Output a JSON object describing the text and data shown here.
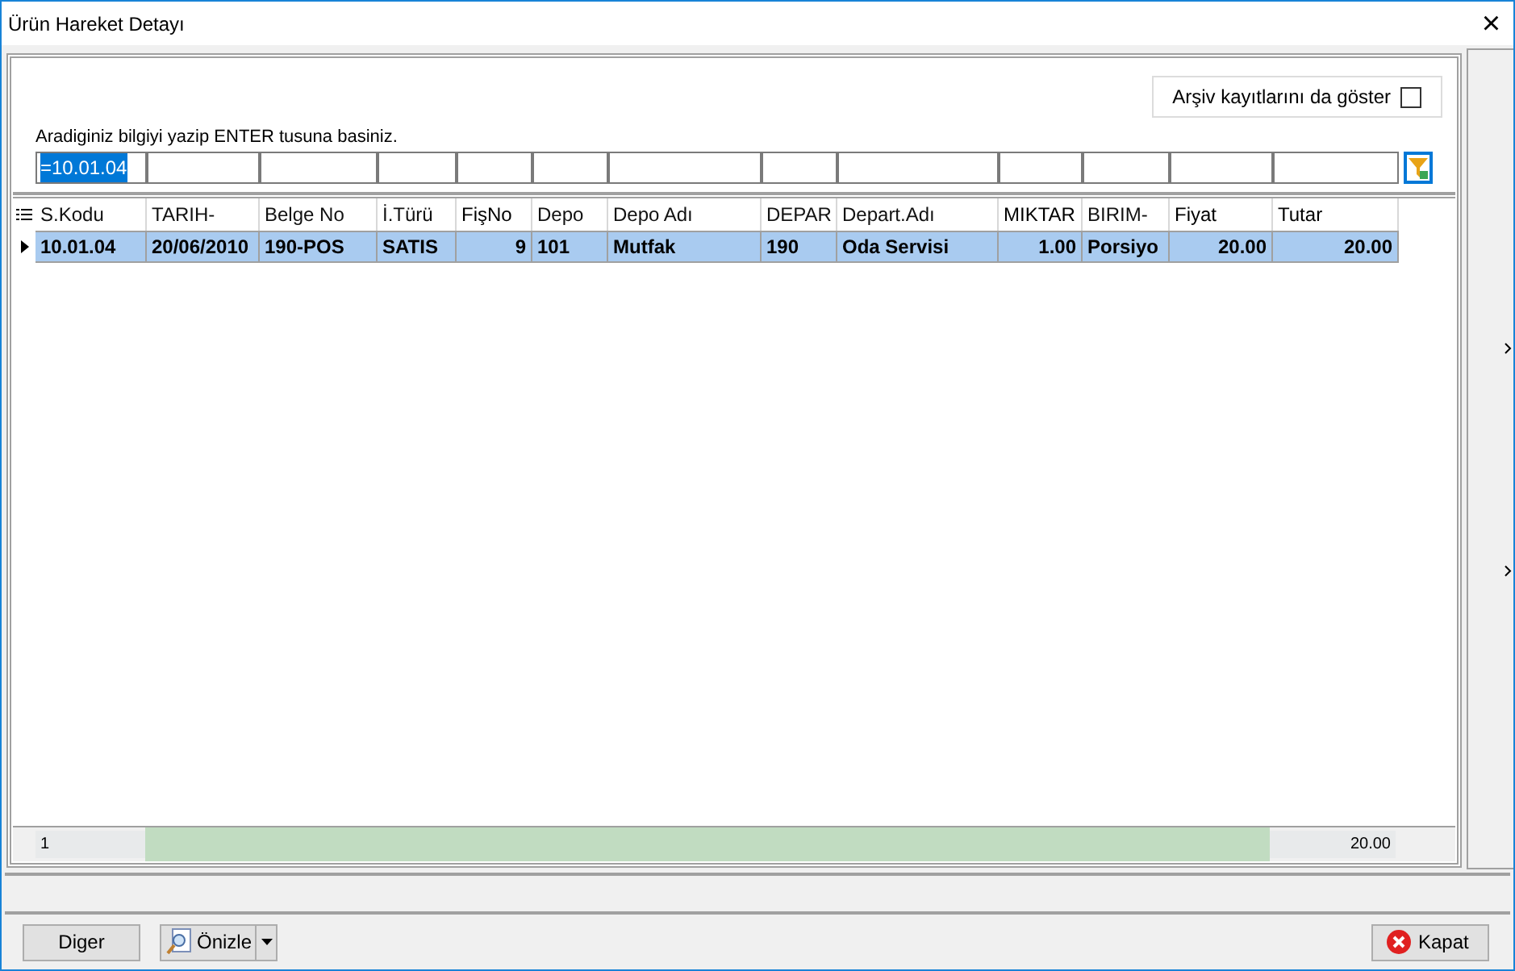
{
  "window": {
    "title": "Ürün Hareket Detayı",
    "close": "×"
  },
  "archive_checkbox": {
    "label": "Arşiv kayıtlarını da göster",
    "checked": false
  },
  "search_hint": "Aradiginiz bilgiyi yazip ENTER tusuna basiniz.",
  "search_field": {
    "value": "=10.01.04",
    "selected": true
  },
  "table": {
    "columns": [
      {
        "label": "S.Kodu",
        "kind": "text"
      },
      {
        "label": "TARIH-",
        "kind": "text"
      },
      {
        "label": "Belge No",
        "kind": "text"
      },
      {
        "label": "İ.Türü",
        "kind": "text"
      },
      {
        "label": "FişNo",
        "kind": "number"
      },
      {
        "label": "Depo",
        "kind": "text"
      },
      {
        "label": "Depo Adı",
        "kind": "text"
      },
      {
        "label": "DEPAR",
        "kind": "text"
      },
      {
        "label": "Depart.Adı",
        "kind": "text"
      },
      {
        "label": "MIKTAR",
        "kind": "number"
      },
      {
        "label": "BIRIM-",
        "kind": "text"
      },
      {
        "label": "Fiyat",
        "kind": "number"
      },
      {
        "label": "Tutar",
        "kind": "number"
      }
    ],
    "rows": [
      {
        "selected": true,
        "cells": [
          "10.01.04",
          "20/06/2010",
          "190-POS",
          "SATIS",
          "9",
          "101",
          "Mutfak",
          "190",
          "Oda Servisi",
          "1.00",
          "Porsiyo",
          "20.00",
          "20.00"
        ]
      }
    ],
    "footer": {
      "count": "1",
      "total": "20.00"
    }
  },
  "buttons": {
    "other": "Diger",
    "preview": "Önizle",
    "close": "Kapat"
  }
}
